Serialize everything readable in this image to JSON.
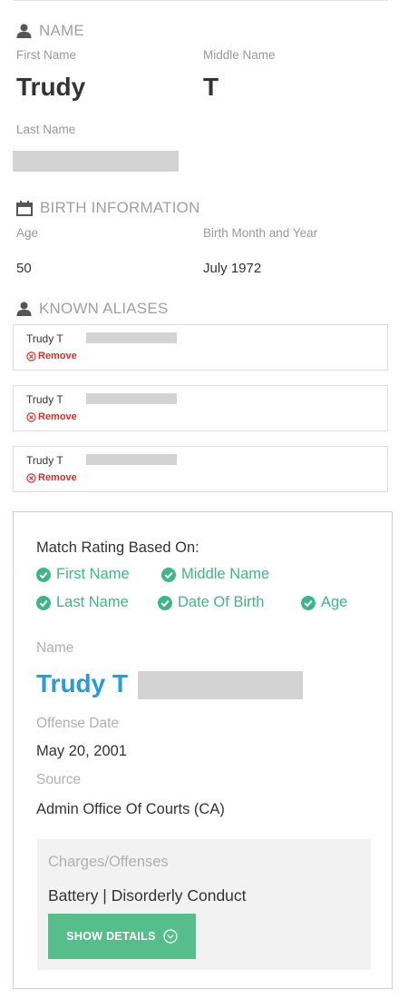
{
  "colors": {
    "accent_green": "#3fb58a",
    "button_green": "#56be8a",
    "name_blue": "#2b9bd2",
    "remove_red": "#d0312d",
    "redaction_gray": "#d3d3d3"
  },
  "name_section": {
    "title": "NAME",
    "icon": "person-icon",
    "first_name_label": "First Name",
    "first_name": "Trudy",
    "middle_name_label": "Middle Name",
    "middle_name": "T",
    "last_name_label": "Last Name"
  },
  "birth_section": {
    "title": "BIRTH INFORMATION",
    "icon": "calendar-icon",
    "age_label": "Age",
    "age": "50",
    "birth_label": "Birth Month and Year",
    "birth": "July 1972"
  },
  "aliases_section": {
    "title": "KNOWN ALIASES",
    "icon": "person-icon",
    "items": [
      {
        "name": "Trudy T",
        "remove_label": "Remove"
      },
      {
        "name": "Trudy T",
        "remove_label": "Remove"
      },
      {
        "name": "Trudy T",
        "remove_label": "Remove"
      }
    ]
  },
  "record": {
    "match_title": "Match Rating Based On:",
    "matches": [
      "First Name",
      "Middle Name",
      "Last Name",
      "Date Of Birth",
      "Age"
    ],
    "name_label": "Name",
    "name": "Trudy T",
    "offense_date_label": "Offense Date",
    "offense_date": "May 20, 2001",
    "source_label": "Source",
    "source": "Admin Office Of Courts (CA)",
    "charges_label": "Charges/Offenses",
    "charges": "Battery | Disorderly Conduct",
    "show_details_label": "SHOW DETAILS"
  }
}
